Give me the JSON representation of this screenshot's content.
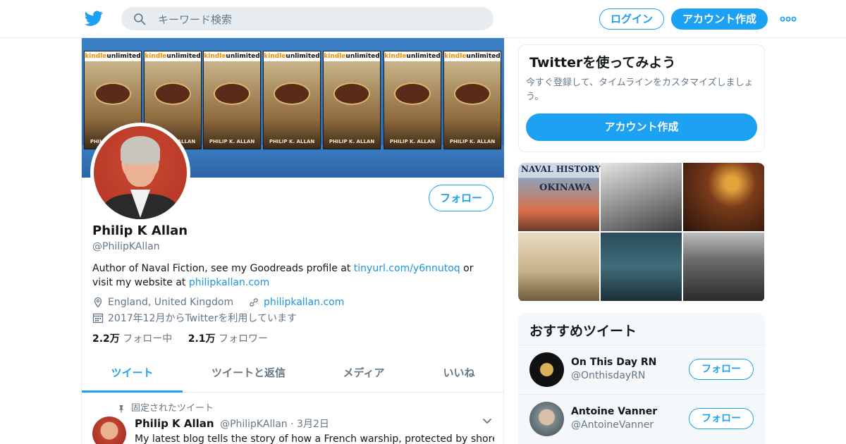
{
  "colors": {
    "accent": "#1da1f2",
    "link": "#1b95e0",
    "muted": "#657786",
    "text": "#14171a",
    "border": "#e6ecf0"
  },
  "header": {
    "logo_icon": "twitter-bird-icon",
    "search_placeholder": "キーワード検索",
    "login_label": "ログイン",
    "signup_label": "アカウント作成",
    "more_icon": "more-dots-icon"
  },
  "banner": {
    "books": [
      {
        "badge_a": "kindle",
        "badge_b": "unlimited",
        "author": "PHILIP K. ALLAN"
      },
      {
        "badge_a": "kindle",
        "badge_b": "unlimited",
        "author": "PHILIP K. ALLAN"
      },
      {
        "badge_a": "kindle",
        "badge_b": "unlimited",
        "author": "PHILIP K. ALLAN"
      },
      {
        "badge_a": "kindle",
        "badge_b": "unlimited",
        "author": "PHILIP K. ALLAN"
      },
      {
        "badge_a": "kindle",
        "badge_b": "unlimited",
        "author": "PHILIP K. ALLAN"
      },
      {
        "badge_a": "kindle",
        "badge_b": "unlimited",
        "author": "PHILIP K. ALLAN"
      },
      {
        "badge_a": "kindle",
        "badge_b": "unlimited",
        "author": "PHILIP K. ALLAN"
      }
    ]
  },
  "profile": {
    "follow_label": "フォロー",
    "name": "Philip K Allan",
    "handle": "@PhilipKAllan",
    "bio_part1": "Author of Naval Fiction, see my Goodreads profile at ",
    "bio_link1": "tinyurl.com/y6nnutoq",
    "bio_part2": " or visit my website at ",
    "bio_link2": "philipkallan.com",
    "location": "England, United Kingdom",
    "website": "philipkallan.com",
    "joined": "2017年12月からTwitterを利用しています",
    "following_count": "2.2万",
    "following_label": "フォロー中",
    "followers_count": "2.1万",
    "followers_label": "フォロワー"
  },
  "tabs": [
    {
      "label": "ツイート",
      "active": true
    },
    {
      "label": "ツイートと返信",
      "active": false
    },
    {
      "label": "メディア",
      "active": false
    },
    {
      "label": "いいね",
      "active": false
    }
  ],
  "tweet": {
    "pinned_label": "固定されたツイート",
    "name": "Philip K Allan",
    "handle": "@PhilipKAllan",
    "separator": "·",
    "date": "3月2日",
    "text": "My latest blog tells the story of how a French warship, protected by shore"
  },
  "signup_card": {
    "title": "Twitterを使ってみよう",
    "desc": "今すぐ登録して、タイムラインをカスタマイズしましょう。",
    "button": "アカウント作成"
  },
  "media_grid": {
    "first_tile_title": "NAVAL HISTORY",
    "first_tile_subtitle": "OKINAWA"
  },
  "recommended": {
    "title": "おすすめツイート",
    "items": [
      {
        "name": "On This Day RN",
        "handle": "@OnthisdayRN",
        "button": "フォロー"
      },
      {
        "name": "Antoine Vanner",
        "handle": "@AntoineVanner",
        "button": "フォロー"
      }
    ]
  }
}
